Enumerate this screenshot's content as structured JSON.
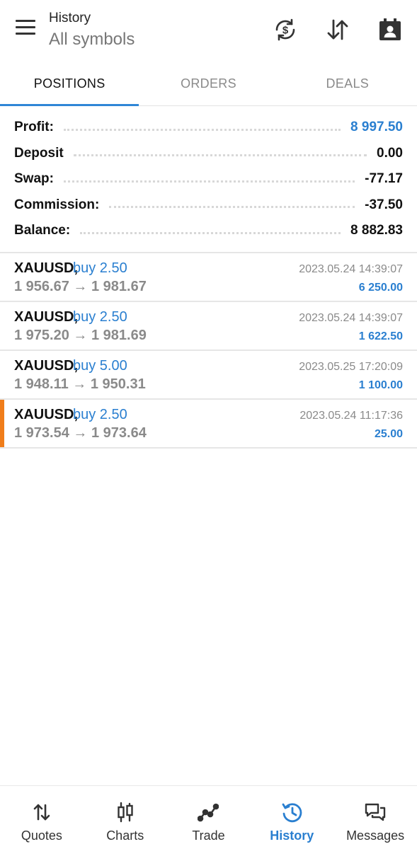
{
  "header": {
    "title": "History",
    "subtitle": "All symbols",
    "icons": [
      "menu-icon",
      "currency-sync-icon",
      "sort-icon",
      "contact-icon"
    ]
  },
  "tabs": [
    {
      "label": "POSITIONS",
      "active": true
    },
    {
      "label": "ORDERS",
      "active": false
    },
    {
      "label": "DEALS",
      "active": false
    }
  ],
  "summary": {
    "profit": {
      "label": "Profit:",
      "value": "8 997.50"
    },
    "deposit": {
      "label": "Deposit",
      "value": "0.00"
    },
    "swap": {
      "label": "Swap:",
      "value": "-77.17"
    },
    "commission": {
      "label": "Commission:",
      "value": "-37.50"
    },
    "balance": {
      "label": "Balance:",
      "value": "8 882.83"
    }
  },
  "positions": [
    {
      "symbol": "XAUUSD,",
      "side": "buy 2.50",
      "prices": "1 956.67 → 1 981.67",
      "time": "2023.05.24 14:39:07",
      "profit": "6 250.00",
      "highlighted": false
    },
    {
      "symbol": "XAUUSD,",
      "side": "buy 2.50",
      "prices": "1 975.20 → 1 981.69",
      "time": "2023.05.24 14:39:07",
      "profit": "1 622.50",
      "highlighted": false
    },
    {
      "symbol": "XAUUSD,",
      "side": "buy 5.00",
      "prices": "1 948.11 → 1 950.31",
      "time": "2023.05.25 17:20:09",
      "profit": "1 100.00",
      "highlighted": false
    },
    {
      "symbol": "XAUUSD,",
      "side": "buy 2.50",
      "prices": "1 973.54 → 1 973.64",
      "time": "2023.05.24 11:17:36",
      "profit": "25.00",
      "highlighted": true
    }
  ],
  "nav": [
    {
      "label": "Quotes",
      "icon": "quotes-icon",
      "active": false
    },
    {
      "label": "Charts",
      "icon": "charts-icon",
      "active": false
    },
    {
      "label": "Trade",
      "icon": "trade-icon",
      "active": false
    },
    {
      "label": "History",
      "icon": "history-icon",
      "active": true
    },
    {
      "label": "Messages",
      "icon": "messages-icon",
      "active": false
    }
  ],
  "colors": {
    "accent": "#2a7fd0",
    "highlight_marker": "#f07d1a",
    "muted_text": "#8a8a8a"
  }
}
